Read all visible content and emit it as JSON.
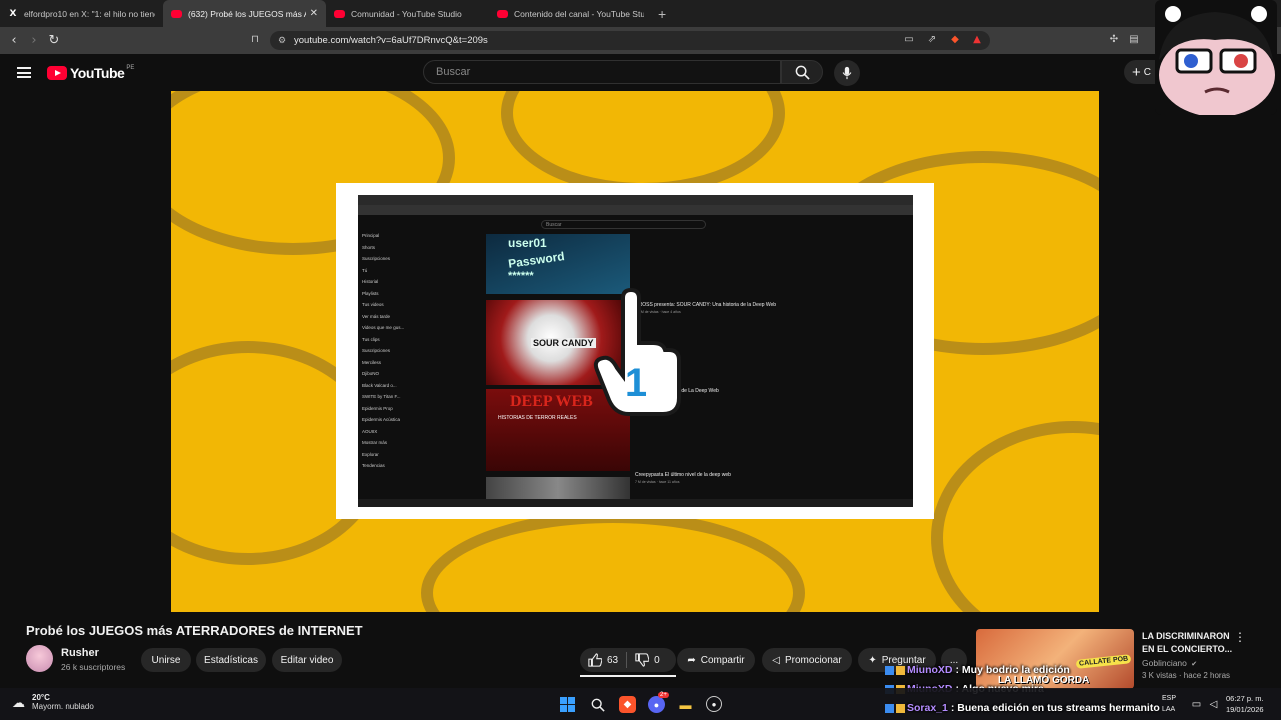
{
  "browser": {
    "tabs": [
      {
        "title": "elfordpro10 en X: \"1: el hilo no tiene",
        "icon": "x-logo-icon",
        "active": false
      },
      {
        "title": "(632) Probé los JUEGOS más ATE",
        "icon": "youtube-icon",
        "active": true
      },
      {
        "title": "Comunidad - YouTube Studio",
        "icon": "youtube-icon",
        "active": false
      },
      {
        "title": "Contenido del canal - YouTube Studio",
        "icon": "youtube-icon",
        "active": false
      }
    ],
    "close_glyph": "✕",
    "new_tab_glyph": "+",
    "url": "youtube.com/watch?v=6aUf7DRnvcQ&t=209s"
  },
  "youtube": {
    "logo_text": "YouTube",
    "region": "PE",
    "search_placeholder": "Buscar",
    "create_label": "C"
  },
  "embedded": {
    "search_placeholder": "Buscar",
    "sidebar_items": [
      "Principal",
      "Shorts",
      "Suscripciones",
      "Tú",
      "Historial",
      "Playlists",
      "Tus videos",
      "Ver más tarde",
      "Videos que me gus...",
      "Tus clips",
      "Suscripciones",
      "Merciless",
      "DjiboNO",
      "Black Valcard o...",
      "SWITE by Titan F...",
      "Epidermis Prop",
      "Epidermis Acústica",
      "AOUIIX",
      "Mostrar más",
      "Explorar",
      "Tendencias"
    ],
    "thumb_labels": [
      "user01",
      "Password",
      "******",
      "SOUR CANDY",
      "DEEP WEB",
      "HISTORIAS DE TERROR REALES"
    ],
    "videos": [
      {
        "title": "DROSS presenta: SOUR CANDY: Una historia de la Deep Web",
        "meta": "5.6 M de vistas · hace 4 años"
      },
      {
        "title": "...s de Terror Reales de La Deep Web",
        "meta": ""
      },
      {
        "title": "Creepypasta El último nivel de la deep web",
        "meta": "7 M de vistas · hace 11 años"
      }
    ],
    "hand_number": "1"
  },
  "video": {
    "title": "Probé los JUEGOS más ATERRADORES de INTERNET",
    "channel": "Rusher",
    "subscribers": "26 k suscriptores",
    "buttons": {
      "join": "Unirse",
      "stats": "Estadísticas",
      "edit": "Editar video"
    },
    "likes": "63",
    "dislikes": "0",
    "share": "Compartir",
    "promote": "Promocionar",
    "ask": "Preguntar",
    "more": "..."
  },
  "suggested": {
    "title": "LA DISCRIMINARON EN EL CONCIERTO...",
    "channel": "Goblinciano",
    "meta": "3 K vistas · hace 2 horas",
    "thumb_text_1": "CALLATE POB",
    "thumb_text_2": "LA LLAMÓ GORDA"
  },
  "chat": [
    {
      "user": "MiunoXD",
      "message": ": Muy bodrio la edición"
    },
    {
      "user": "MiunoXD",
      "message": ": Algo nuevo mira"
    },
    {
      "user": "Sorax_1",
      "message": ": Buena edición en tus streams hermanito"
    }
  ],
  "taskbar": {
    "temp": "20°C",
    "weather": "Mayorm. nublado",
    "lang_1": "ESP",
    "lang_2": "LAA",
    "time": "06:27 p. m.",
    "date": "19/01/2026",
    "discord_badge": "2+"
  }
}
